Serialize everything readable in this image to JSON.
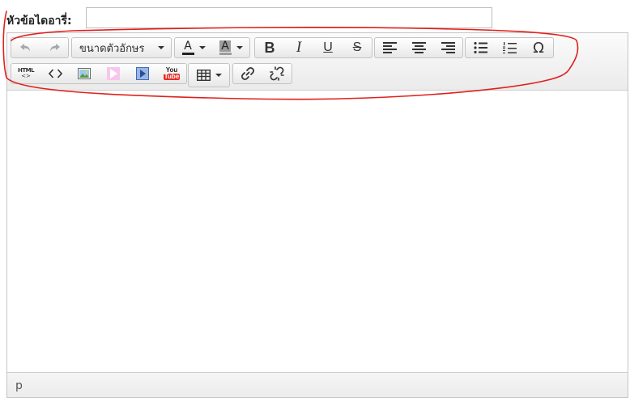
{
  "form": {
    "title_label": "หัวข้อไดอารี่:",
    "title_value": ""
  },
  "toolbar": {
    "row1": {
      "undo": "undo-icon",
      "redo": "redo-icon",
      "font_size_label": "ขนาดตัวอักษร",
      "text_color_letter": "A",
      "bg_color_letter": "A",
      "bold": "B",
      "italic": "I",
      "underline": "U",
      "strike": "S",
      "omega": "Ω"
    },
    "row2": {
      "html_label": "HTML",
      "youtube_top": "You",
      "youtube_bottom": "Tube"
    }
  },
  "statusbar": {
    "path": "p"
  },
  "colors": {
    "annotation": "#e0201c",
    "text_color_underline": "#222222",
    "bg_color_fill": "#999999",
    "youtube_red": "#e52d27",
    "flash_pink": "#f28ad8",
    "media_blue": "#3b6db8"
  }
}
